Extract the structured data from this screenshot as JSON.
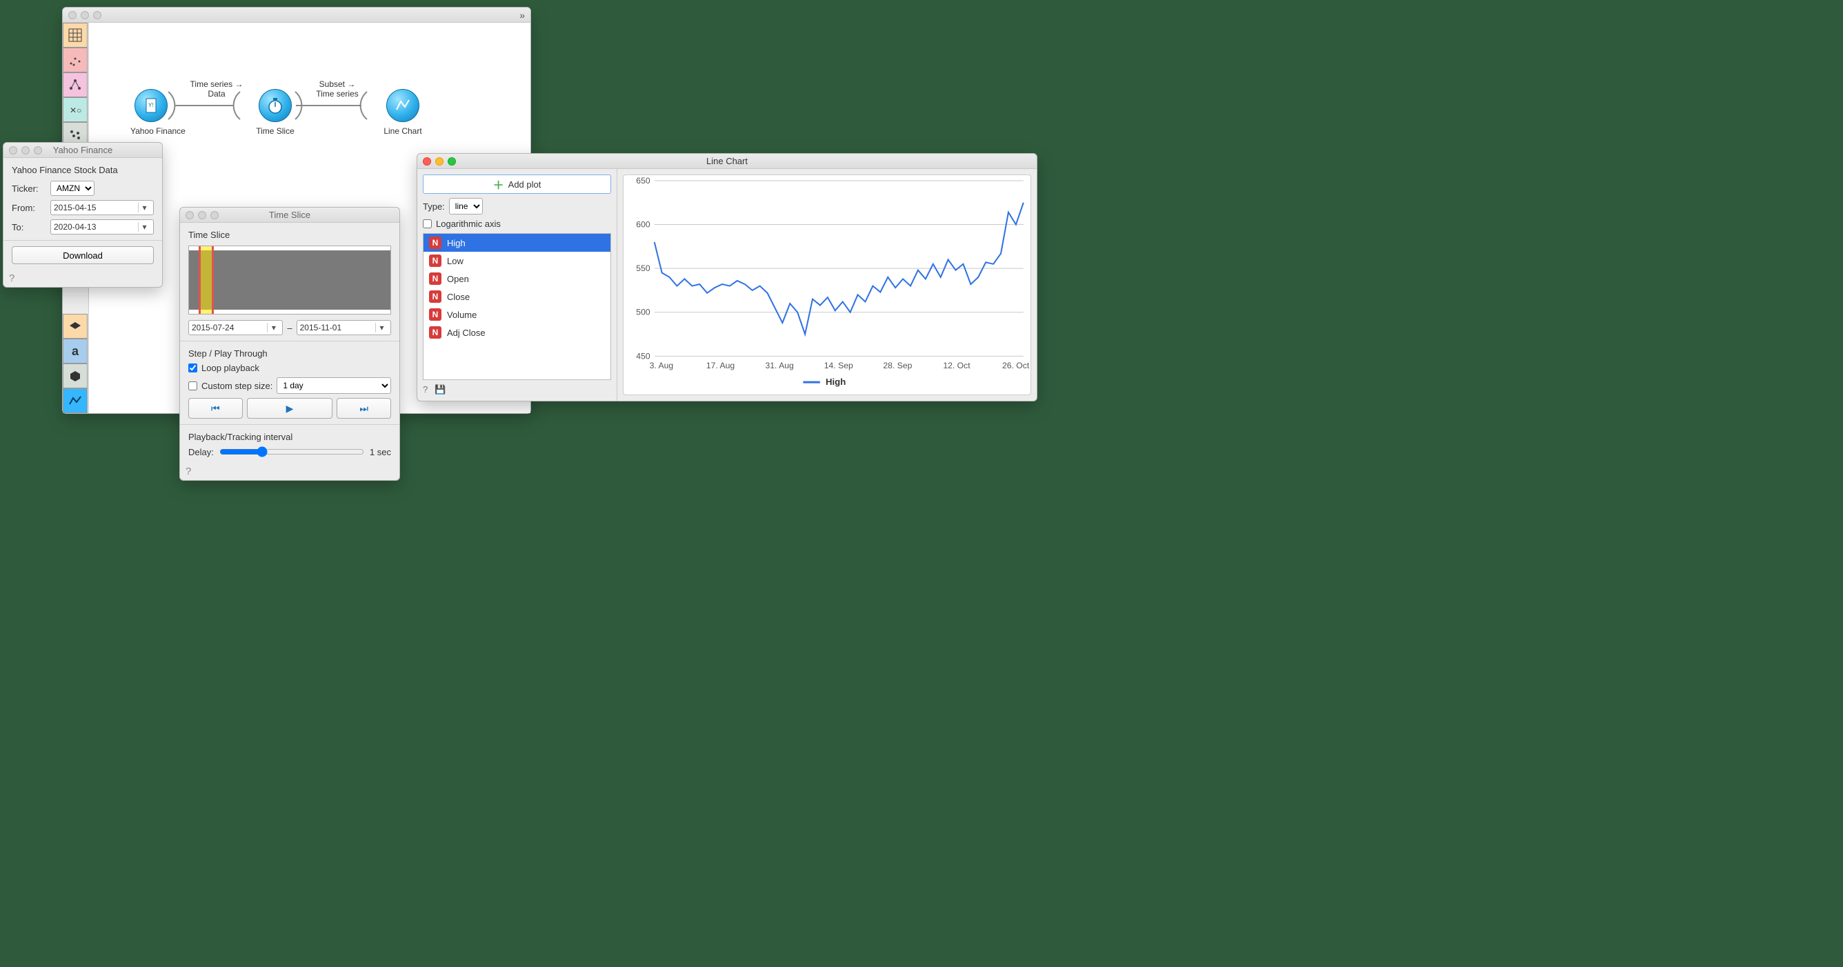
{
  "canvas": {
    "collapse_glyph": "»",
    "nodes": [
      {
        "id": "yahoo",
        "label": "Yahoo Finance"
      },
      {
        "id": "slice",
        "label": "Time Slice"
      },
      {
        "id": "chart",
        "label": "Line Chart"
      }
    ],
    "edge_labels": {
      "e1_line1": "Time series →",
      "e1_line2": "Data",
      "e2_line1": "Subset →",
      "e2_line2": "Time series"
    }
  },
  "yahoo": {
    "title": "Yahoo Finance",
    "header": "Yahoo Finance Stock Data",
    "ticker_label": "Ticker:",
    "ticker_value": "AMZN",
    "from_label": "From:",
    "from_value": "2015-04-15",
    "to_label": "To:",
    "to_value": "2020-04-13",
    "download": "Download"
  },
  "timeslice": {
    "title": "Time Slice",
    "heading": "Time Slice",
    "range_from": "2015-07-24",
    "range_sep": "–",
    "range_to": "2015-11-01",
    "step_heading": "Step / Play Through",
    "loop_label": "Loop playback",
    "custom_label": "Custom step size:",
    "custom_value": "1 day",
    "interval_heading": "Playback/Tracking interval",
    "delay_label": "Delay:",
    "delay_value": "1 sec"
  },
  "linechart": {
    "title": "Line Chart",
    "add_plot": "Add plot",
    "type_label": "Type:",
    "type_value": "line",
    "log_label": "Logarithmic axis",
    "vars": [
      "High",
      "Low",
      "Open",
      "Close",
      "Volume",
      "Adj Close"
    ],
    "selected_var": "High",
    "legend": "High"
  },
  "chart_data": {
    "type": "line",
    "title": "",
    "xlabel": "",
    "ylabel": "",
    "ylim": [
      450,
      650
    ],
    "yticks": [
      450,
      500,
      550,
      600,
      650
    ],
    "xticks": [
      "3. Aug",
      "17. Aug",
      "31. Aug",
      "14. Sep",
      "28. Sep",
      "12. Oct",
      "26. Oct"
    ],
    "series": [
      {
        "name": "High",
        "x": [
          0,
          1,
          2,
          3,
          4,
          5,
          6,
          7,
          8,
          9,
          10,
          11,
          12,
          13,
          14,
          15,
          16,
          17,
          18,
          19,
          20,
          21,
          22,
          23,
          24,
          25,
          26,
          27,
          28,
          29,
          30,
          31,
          32,
          33,
          34,
          35,
          36,
          37,
          38,
          39,
          40,
          41,
          42,
          43,
          44,
          45,
          46,
          47,
          48,
          49
        ],
        "values": [
          580,
          545,
          540,
          530,
          538,
          530,
          532,
          522,
          528,
          532,
          530,
          536,
          532,
          525,
          530,
          522,
          505,
          488,
          510,
          500,
          475,
          515,
          508,
          517,
          502,
          512,
          500,
          520,
          512,
          530,
          523,
          540,
          528,
          538,
          530,
          548,
          538,
          555,
          540,
          560,
          548,
          555,
          532,
          540,
          557,
          555,
          567,
          614,
          600,
          625
        ]
      }
    ]
  }
}
